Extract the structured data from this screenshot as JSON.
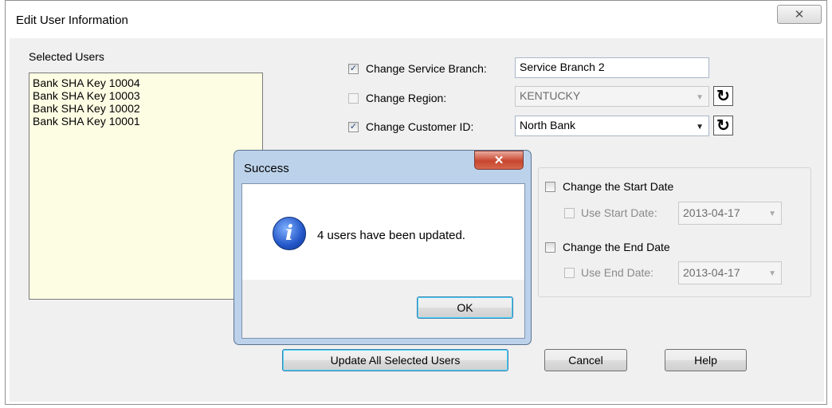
{
  "window": {
    "title": "Edit User Information",
    "close_glyph": "✕"
  },
  "selected_users": {
    "label": "Selected Users",
    "items": [
      "Bank SHA Key 10004",
      "Bank SHA Key 10003",
      "Bank SHA Key 10002",
      "Bank SHA Key 10001"
    ]
  },
  "service_branch": {
    "label": "Change Service Branch:",
    "checked": true,
    "value": "Service Branch 2"
  },
  "region": {
    "label": "Change Region:",
    "checked": false,
    "value": "KENTUCKY",
    "enabled": false
  },
  "customer_id": {
    "label": "Change Customer ID:",
    "checked": true,
    "value": "North Bank"
  },
  "dates": {
    "start_label": "Change the Start Date",
    "use_start_label": "Use Start Date:",
    "start_value": "2013-04-17",
    "end_label": "Change the End Date",
    "use_end_label": "Use End Date:",
    "end_value": "2013-04-17"
  },
  "buttons": {
    "update": "Update All Selected Users",
    "cancel": "Cancel",
    "help": "Help"
  },
  "dialog": {
    "title": "Success",
    "message": "4 users have been updated.",
    "ok": "OK",
    "close_glyph": "✕",
    "icon_glyph": "i"
  },
  "icons": {
    "checkmark": "✓",
    "dropdown": "▼",
    "refresh": "↻"
  }
}
